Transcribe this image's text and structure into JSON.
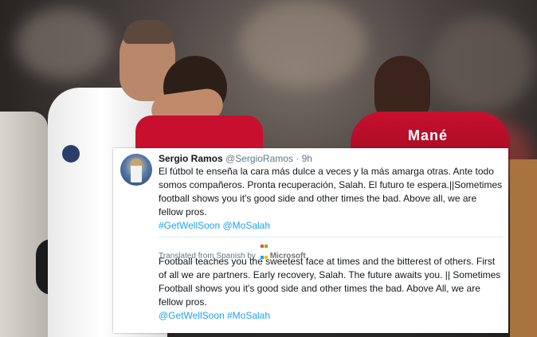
{
  "tweet": {
    "name": "Sergio Ramos",
    "handle": "@SergioRamos",
    "separator": " · ",
    "time": "9h",
    "text_es": "El fútbol te enseña la cara más dulce a veces y la más amarga otras. Ante todo somos compañeros. Pronta recuperación, Salah. El futuro te espera.||Sometimes football shows you it's good side and other times the bad. Above all, we are fellow pros.",
    "tags_es": "#GetWellSoon @MoSalah",
    "translated_from": "Translated from Spanish by",
    "translator": "Microsoft",
    "text_en": "Football teaches you the sweetest face at times and the bitterest of others. First of all we are partners. Early recovery, Salah. The future awaits you. || Sometimes Football shows you it's good side and other times the bad. Above All, we are fellow pros.",
    "tags_en": "@GetWellSoon #MoSalah"
  },
  "photo": {
    "jersey_name": "Mané"
  },
  "colors": {
    "link": "#1da1f2",
    "liverpool_red": "#c8102e",
    "madrid_white": "#f4f4f4"
  }
}
